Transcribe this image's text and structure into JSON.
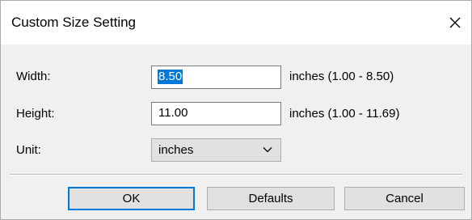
{
  "dialog": {
    "title": "Custom Size Setting",
    "close_icon": "close-icon"
  },
  "width": {
    "label": "Width:",
    "value": "8.50",
    "range": "inches (1.00 - 8.50)"
  },
  "height": {
    "label": "Height:",
    "value": "11.00",
    "range": "inches (1.00 - 11.69)"
  },
  "unit": {
    "label": "Unit:",
    "selected": "inches",
    "icon": "chevron-down-icon"
  },
  "buttons": {
    "ok": "OK",
    "defaults": "Defaults",
    "cancel": "Cancel"
  },
  "colors": {
    "selection": "#0078d7",
    "dialog_bg": "#f0f0f0",
    "button_bg": "#e1e1e1"
  }
}
